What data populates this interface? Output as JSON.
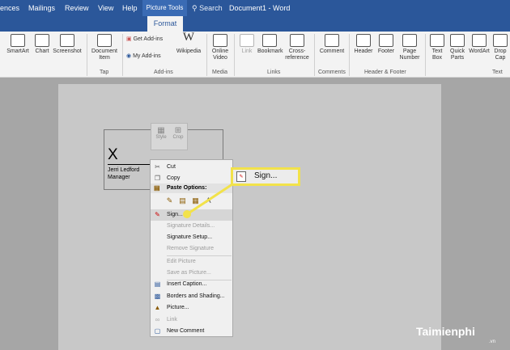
{
  "titlebar": {
    "partial_tab": "ences",
    "picture_tools": "Picture Tools",
    "search": "Search",
    "document_title": "Document1  -  Word"
  },
  "tabs": [
    "ences",
    "Mailings",
    "Review",
    "View",
    "Help",
    "Format"
  ],
  "ribbon": {
    "buttons": {
      "smartart": "SmartArt",
      "chart": "Chart",
      "screenshot": "Screenshot",
      "document_item": "Document Item",
      "get_addins": "Get Add-ins",
      "my_addins": "My Add-ins",
      "wikipedia": "Wikipedia",
      "online_video": "Online Video",
      "link": "Link",
      "bookmark": "Bookmark",
      "cross_reference": "Cross-reference",
      "comment": "Comment",
      "header": "Header",
      "footer": "Footer",
      "page_number": "Page Number",
      "text_box": "Text Box",
      "quick_parts": "Quick Parts",
      "wordart": "WordArt",
      "drop_cap": "Drop Cap"
    },
    "groups": {
      "tap": "Tap",
      "addins": "Add-ins",
      "media": "Media",
      "links": "Links",
      "comments": "Comments",
      "header_footer": "Header & Footer",
      "text": "Text"
    }
  },
  "signature": {
    "x": "X",
    "name": "Jerri Ledford",
    "title": "Manager"
  },
  "mini_toolbar": {
    "style": "Style",
    "crop": "Crop"
  },
  "context_menu": {
    "cut": "Cut",
    "copy": "Copy",
    "paste_options": "Paste Options:",
    "sign": "Sign...",
    "signature_details": "Signature Details...",
    "signature_setup": "Signature Setup...",
    "remove_signature": "Remove Signature",
    "edit_picture": "Edit Picture",
    "save_as_picture": "Save as Picture...",
    "insert_caption": "Insert Caption...",
    "borders_shading": "Borders and Shading...",
    "picture": "Picture...",
    "link": "Link",
    "new_comment": "New Comment"
  },
  "callout": {
    "label": "Sign..."
  },
  "colors": {
    "titlebar": "#2b579a",
    "highlight": "#f2e24a"
  },
  "watermark": {
    "text": "Taimienphi",
    "sub": ".vn"
  }
}
